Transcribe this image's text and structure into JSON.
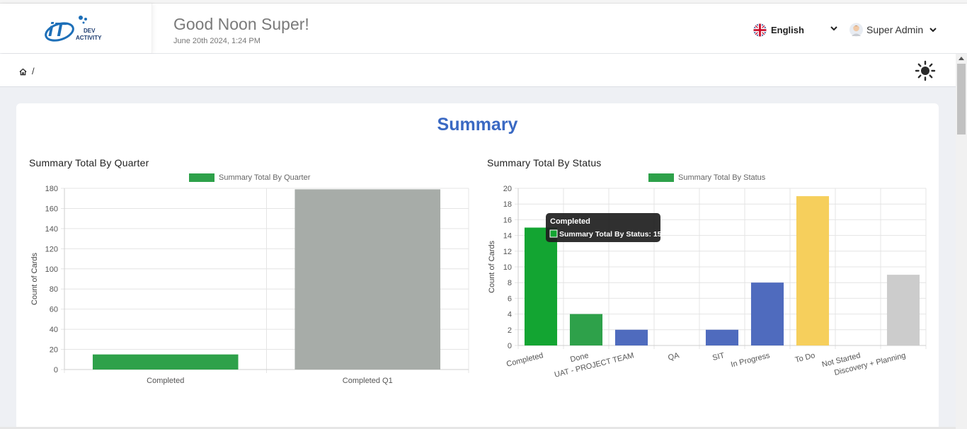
{
  "header": {
    "logo_text": [
      "DEV",
      "ACTIVITY"
    ],
    "greeting": "Good Noon Super!",
    "date": "June 20th 2024, 1:24 PM",
    "language": "English",
    "language_icon": "uk-flag-icon",
    "user_name": "Super Admin",
    "user_icon": "avatar"
  },
  "breadcrumb": {
    "separator": "/"
  },
  "page": {
    "title": "Summary"
  },
  "charts": {
    "quarter": {
      "heading": "Summary Total By Quarter"
    },
    "status": {
      "heading": "Summary Total By Status"
    }
  },
  "tooltip": {
    "title": "Completed",
    "text": "Summary Total By Status: 15"
  },
  "chart_data": [
    {
      "type": "bar",
      "title": "Summary Total By Quarter",
      "legend": "Summary Total By Quarter",
      "ylabel": "Count of Cards",
      "categories": [
        "Completed",
        "Completed Q1"
      ],
      "values": [
        15,
        179
      ],
      "colors": [
        "#2ea14a",
        "#a7aca8"
      ],
      "ylim": [
        0,
        180
      ],
      "yticks": [
        0,
        20,
        40,
        60,
        80,
        100,
        120,
        140,
        160,
        180
      ],
      "grid": true,
      "legend_position": "top"
    },
    {
      "type": "bar",
      "title": "Summary Total By Status",
      "legend": "Summary Total By Status",
      "ylabel": "Count of Cards",
      "categories": [
        "Completed",
        "Done",
        "UAT - PROJECT TEAM",
        "QA",
        "SIT",
        "In Progress",
        "To Do",
        "Not Started",
        "Discovery + Planning"
      ],
      "values": [
        15,
        4,
        2,
        0,
        2,
        8,
        19,
        0,
        9
      ],
      "colors": [
        "#13a532",
        "#2ea14a",
        "#4f6bbe",
        "#4f6bbe",
        "#4f6bbe",
        "#4f6bbe",
        "#f6cf5c",
        "#cccccc",
        "#cccccc"
      ],
      "ylim": [
        0,
        20
      ],
      "yticks": [
        0,
        2,
        4,
        6,
        8,
        10,
        12,
        14,
        16,
        18,
        20
      ],
      "grid": true,
      "legend_position": "top"
    }
  ]
}
